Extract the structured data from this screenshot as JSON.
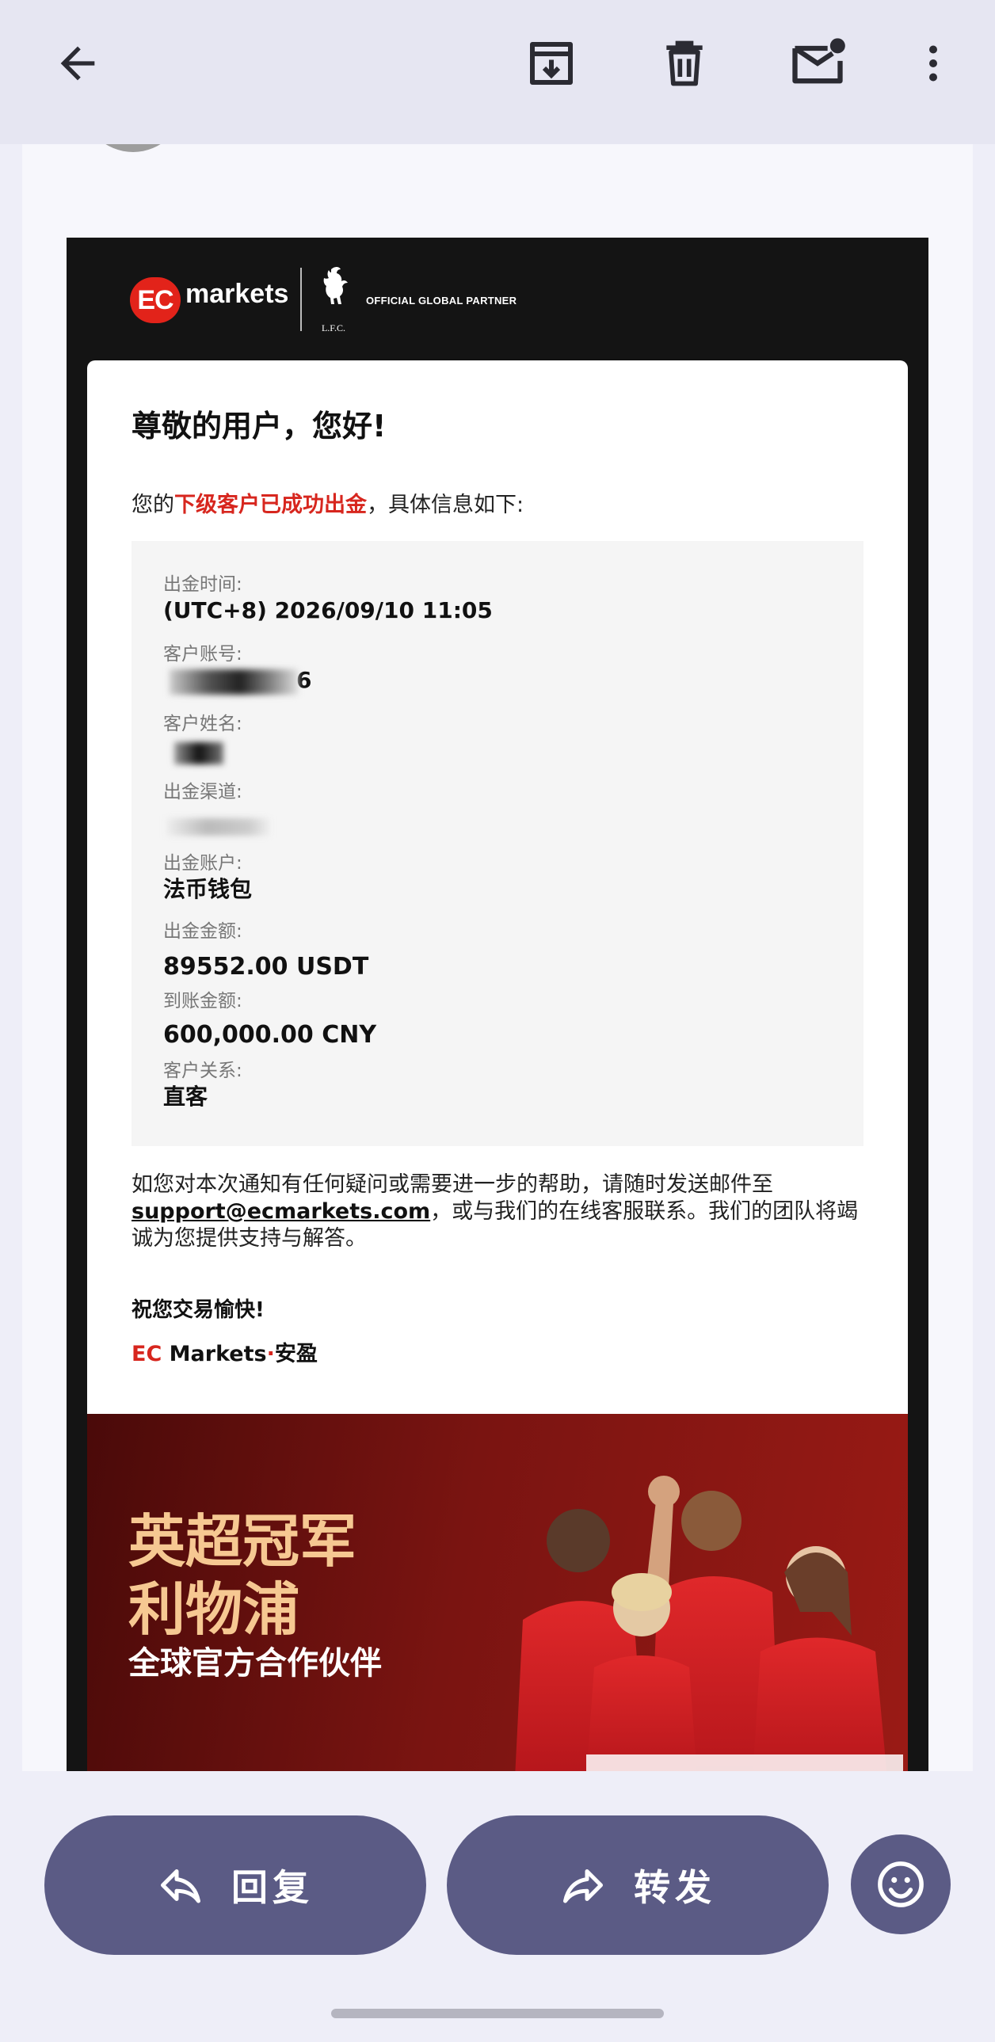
{
  "email": {
    "brand": {
      "badge": "EC",
      "word": "markets",
      "partner": "OFFICIAL GLOBAL PARTNER",
      "lfc": "L.F.C.",
      "accent_color": "#e2231a"
    },
    "greeting": "尊敬的用户，您好!",
    "intro": {
      "prefix": "您的",
      "highlight": "下级客户已成功出金",
      "suffix": "，具体信息如下:"
    },
    "fields": {
      "time": {
        "label": "出金时间:",
        "value": "(UTC+8) 2026/09/10 11:05"
      },
      "account_no": {
        "label": "客户账号:",
        "value": "6"
      },
      "name": {
        "label": "客户姓名:"
      },
      "channel": {
        "label": "出金渠道:"
      },
      "account": {
        "label": "出金账户:",
        "value": "法币钱包"
      },
      "amount": {
        "label": "出金金额:",
        "value": "89552.00  USDT"
      },
      "received": {
        "label": "到账金额:",
        "value": "600,000.00  CNY"
      },
      "relation": {
        "label": "客户关系:",
        "value": "直客"
      }
    },
    "help": {
      "line1": "如您对本次通知有任何疑问或需要进一步的帮助，请随时发送邮件至",
      "email": "support@ecmarkets.com",
      "line2": "，或与我们的在线客服联系。我们的团队将竭诚为您提供支持与解答。"
    },
    "closing": "祝您交易愉快!",
    "signature": {
      "ec": "EC",
      "markets": " Markets",
      "dot": "·",
      "cn": "安盈"
    },
    "banner": {
      "line1": "英超冠军",
      "line2": "利物浦",
      "line3": "全球官方合作伙伴"
    }
  },
  "actions": {
    "reply_label": "回复",
    "forward_label": "转发"
  },
  "icons": {
    "back": "back-arrow-icon",
    "archive": "archive-icon",
    "delete": "trash-icon",
    "unread": "mark-unread-icon",
    "more": "more-vert-icon",
    "reply": "reply-icon",
    "forward": "forward-icon",
    "emoji": "emoji-icon"
  },
  "colors": {
    "button": "#5b5b85",
    "highlight_red": "#d7261e",
    "banner_gold": "#f6c892"
  }
}
